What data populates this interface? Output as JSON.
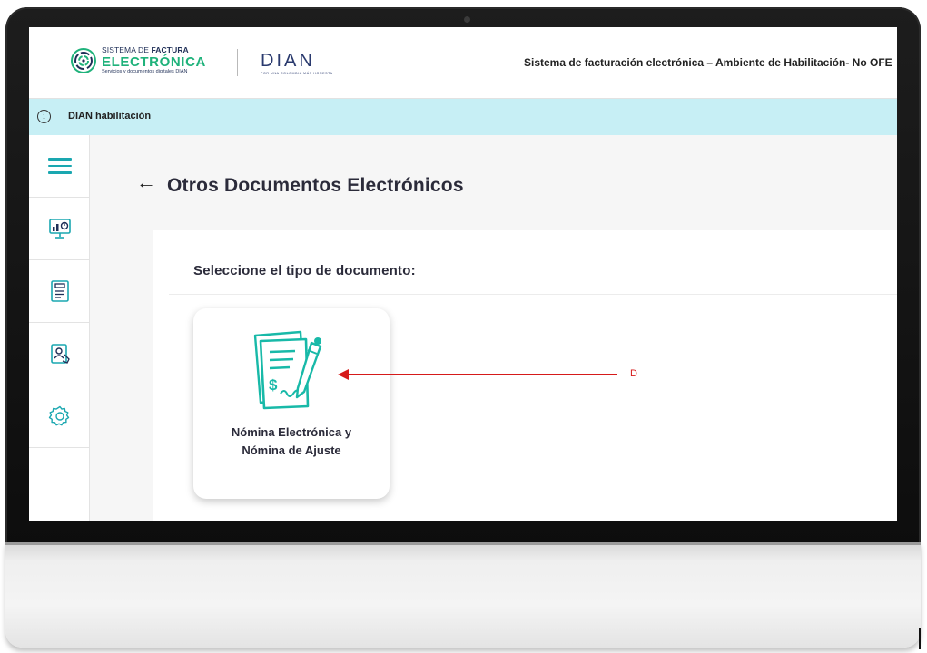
{
  "header": {
    "logo_fe": {
      "top_prefix": "SISTEMA DE ",
      "top_bold": "FACTURA",
      "main": "ELECTRÓNICA",
      "sub": "Servicios y documentos digitales DIAN"
    },
    "logo_dian": {
      "word": "DIAN",
      "tagline": "POR UNA COLOMBIA MÁS HONESTA"
    },
    "title": "Sistema de facturación electrónica – Ambiente de Habilitación- No OFE"
  },
  "infobar": {
    "icon": "info-icon",
    "text": "DIAN habilitación"
  },
  "sidebar": {
    "items": [
      {
        "icon": "hamburger-menu-icon"
      },
      {
        "icon": "monitor-chart-icon"
      },
      {
        "icon": "document-list-icon"
      },
      {
        "icon": "user-document-icon"
      },
      {
        "icon": "gear-icon"
      }
    ]
  },
  "main": {
    "back_icon": "←",
    "title": "Otros Documentos Electrónicos",
    "panel_heading": "Seleccione el tipo de documento:",
    "card": {
      "icon": "payroll-document-icon",
      "label_line1": "Nómina Electrónica y",
      "label_line2": "Nómina de Ajuste"
    }
  },
  "annotation": {
    "text": "D",
    "color": "#d61a1a"
  },
  "colors": {
    "teal_accent": "#1aa7b0",
    "green_brand": "#1fb27b",
    "infobar_bg": "#c7eff5",
    "navy": "#2a3a6e"
  }
}
